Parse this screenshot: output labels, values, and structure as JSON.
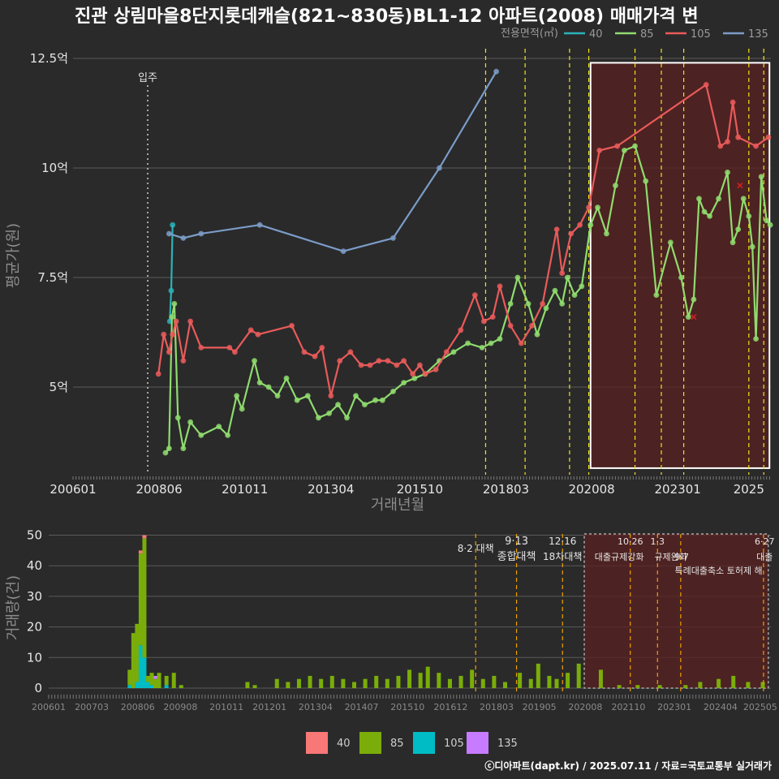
{
  "chart_data": [
    {
      "type": "line",
      "title": "진관 상림마을8단지롯데캐슬(821~830동)BL1-12 아파트(2008) 매매가격 변",
      "xlabel": "거래년월",
      "ylabel": "평균가(원)",
      "xticks": [
        "200601",
        "200806",
        "201011",
        "201304",
        "201510",
        "201803",
        "202008",
        "202301",
        "2025"
      ],
      "yticks": [
        {
          "v": 5,
          "label": "5억"
        },
        {
          "v": 7.5,
          "label": "7.5억"
        },
        {
          "v": 10,
          "label": "10억"
        },
        {
          "v": 12.5,
          "label": "12.5억"
        }
      ],
      "xlim": [
        2006.0,
        2025.62
      ],
      "ylim": [
        3.0,
        13.0
      ],
      "grid": true,
      "legend_title": "전용면적(㎡)",
      "legend_position": "top-right",
      "colors": {
        "40": "#2ab3b8",
        "85": "#8fdc6e",
        "105": "#ea5a5a",
        "135": "#7b9cc8",
        "policy": "#f5e31a",
        "highlight_fill": "#5a2020",
        "highlight_border": "#ffffff"
      },
      "move_in": {
        "x": 2008.1,
        "label": "입주"
      },
      "policy_lines": [
        2017.6,
        2018.71,
        2019.96,
        2020.5,
        2021.8,
        2022.54,
        2023.17,
        2025.0,
        2025.42
      ],
      "highlight": {
        "x0": 2020.55,
        "x1": 2025.58,
        "y0": 3.15,
        "y1": 12.4
      },
      "series": [
        {
          "name": "40",
          "x": [
            2008.72,
            2008.76,
            2008.8
          ],
          "y": [
            6.5,
            7.2,
            8.7
          ]
        },
        {
          "name": "85",
          "x": [
            2008.6,
            2008.7,
            2008.78,
            2008.85,
            2008.95,
            2009.1,
            2009.3,
            2009.6,
            2010.1,
            2010.35,
            2010.6,
            2010.75,
            2011.1,
            2011.25,
            2011.5,
            2011.75,
            2012.0,
            2012.3,
            2012.6,
            2012.9,
            2013.2,
            2013.45,
            2013.7,
            2013.95,
            2014.2,
            2014.5,
            2014.7,
            2015.0,
            2015.3,
            2015.6,
            2015.9,
            2016.3,
            2016.7,
            2017.1,
            2017.5,
            2017.75,
            2018.0,
            2018.3,
            2018.5,
            2018.8,
            2019.05,
            2019.3,
            2019.55,
            2019.75,
            2019.9,
            2020.1,
            2020.3,
            2020.55,
            2020.75,
            2021.0,
            2021.25,
            2021.5,
            2021.8,
            2022.1,
            2022.4,
            2022.8,
            2023.1,
            2023.3,
            2023.45,
            2023.6,
            2023.75,
            2023.9,
            2024.15,
            2024.4,
            2024.55,
            2024.7,
            2024.85,
            2025.0,
            2025.1,
            2025.2,
            2025.35,
            2025.5,
            2025.6
          ],
          "y": [
            3.5,
            3.6,
            6.6,
            6.9,
            4.3,
            3.6,
            4.2,
            3.9,
            4.1,
            3.9,
            4.8,
            4.5,
            5.6,
            5.1,
            5.0,
            4.8,
            5.2,
            4.7,
            4.8,
            4.3,
            4.4,
            4.6,
            4.3,
            4.8,
            4.6,
            4.7,
            4.7,
            4.9,
            5.1,
            5.2,
            5.3,
            5.6,
            5.8,
            6.0,
            5.9,
            6.0,
            6.1,
            6.9,
            7.5,
            6.9,
            6.2,
            6.8,
            7.2,
            6.9,
            7.5,
            7.1,
            7.3,
            8.7,
            9.1,
            8.5,
            9.6,
            10.4,
            10.5,
            9.7,
            7.1,
            8.3,
            7.5,
            6.6,
            7.0,
            9.3,
            9.0,
            8.9,
            9.3,
            9.9,
            8.3,
            8.6,
            9.3,
            8.9,
            8.2,
            6.1,
            9.8,
            8.8,
            8.7
          ]
        },
        {
          "name": "105",
          "x": [
            2008.4,
            2008.55,
            2008.7,
            2008.8,
            2008.9,
            2009.1,
            2009.3,
            2009.6,
            2010.4,
            2010.55,
            2011.0,
            2011.2,
            2012.15,
            2012.5,
            2012.8,
            2013.0,
            2013.25,
            2013.5,
            2013.8,
            2014.1,
            2014.35,
            2014.6,
            2014.85,
            2015.1,
            2015.3,
            2015.55,
            2015.75,
            2015.9,
            2016.2,
            2016.5,
            2016.9,
            2017.3,
            2017.55,
            2017.8,
            2018.0,
            2018.3,
            2018.6,
            2018.9,
            2019.2,
            2019.6,
            2019.75,
            2020.0,
            2020.25,
            2020.5,
            2020.8,
            2021.3,
            2023.8,
            2024.2,
            2024.4,
            2024.55,
            2024.7,
            2025.2,
            2025.55
          ],
          "y": [
            5.3,
            6.2,
            5.8,
            6.2,
            6.5,
            5.6,
            6.5,
            5.9,
            5.9,
            5.8,
            6.3,
            6.2,
            6.4,
            5.8,
            5.7,
            5.9,
            4.8,
            5.6,
            5.8,
            5.5,
            5.5,
            5.6,
            5.6,
            5.5,
            5.6,
            5.3,
            5.5,
            5.3,
            5.4,
            5.8,
            6.3,
            7.1,
            6.5,
            6.6,
            7.3,
            6.4,
            6.0,
            6.4,
            6.9,
            8.6,
            7.6,
            8.5,
            8.7,
            9.1,
            10.4,
            10.5,
            11.9,
            10.5,
            10.6,
            11.5,
            10.7,
            10.5,
            10.7
          ]
        },
        {
          "name": "135",
          "x": [
            2008.7,
            2009.1,
            2009.6,
            2011.25,
            2013.6,
            2015.0,
            2016.3,
            2017.9
          ],
          "y": [
            8.5,
            8.4,
            8.5,
            8.7,
            8.1,
            8.4,
            10.0,
            12.2
          ]
        }
      ],
      "markers": [
        {
          "x": 2023.45,
          "y": 6.6,
          "series": "105"
        },
        {
          "x": 2024.75,
          "y": 9.6,
          "series": "105"
        }
      ]
    },
    {
      "type": "bar",
      "ylabel": "거래량(건)",
      "xticks": [
        "200601",
        "200703",
        "200806",
        "200908",
        "201011",
        "201201",
        "201304",
        "201407",
        "201510",
        "201612",
        "201803",
        "201905",
        "202008",
        "202110",
        "202301",
        "202404",
        "202505"
      ],
      "ylim": [
        0,
        52
      ],
      "yticks": [
        0,
        10,
        20,
        30,
        40,
        50
      ],
      "stacked": true,
      "series_colors": {
        "40": "#f87777",
        "85": "#7aad09",
        "105": "#00bcc4",
        "135": "#c77cff"
      },
      "legend": [
        "40",
        "85",
        "105",
        "135"
      ],
      "policies": [
        {
          "x": 2017.6,
          "label": "8·2 대책"
        },
        {
          "x": 2018.71,
          "label": "9·13 종합대책"
        },
        {
          "x": 2019.96,
          "label": "12·16 18차대책"
        },
        {
          "x": 2021.8,
          "label": "10·26 대출규제강화"
        },
        {
          "x": 2022.54,
          "label": "1·3 규제완화"
        },
        {
          "x": 2023.17,
          "label": "9·7 특례대출축소 토허제 해"
        },
        {
          "x": 2025.42,
          "label": "6·27 대출"
        }
      ],
      "counts_by_period": [
        {
          "x": 2008.2,
          "c85": 5,
          "c105": 1
        },
        {
          "x": 2008.3,
          "c85": 18
        },
        {
          "x": 2008.4,
          "c85": 19,
          "c105": 2
        },
        {
          "x": 2008.5,
          "c85": 30,
          "c105": 14,
          "c40": 1
        },
        {
          "x": 2008.6,
          "c85": 39,
          "c105": 10,
          "c40": 1
        },
        {
          "x": 2008.7,
          "c85": 2,
          "c105": 2
        },
        {
          "x": 2008.8,
          "c85": 4,
          "c105": 1
        },
        {
          "x": 2008.9,
          "c85": 3,
          "c135": 1
        },
        {
          "x": 2009.0,
          "c85": 5
        },
        {
          "x": 2009.2,
          "c85": 3,
          "c105": 1
        },
        {
          "x": 2009.4,
          "c85": 5
        },
        {
          "x": 2009.6,
          "c85": 1
        },
        {
          "x": 2011.4,
          "c85": 2
        },
        {
          "x": 2011.6,
          "c85": 1
        },
        {
          "x": 2012.2,
          "c85": 3
        },
        {
          "x": 2012.5,
          "c85": 2
        },
        {
          "x": 2012.8,
          "c85": 3
        },
        {
          "x": 2013.1,
          "c85": 4
        },
        {
          "x": 2013.4,
          "c85": 3
        },
        {
          "x": 2013.7,
          "c85": 4
        },
        {
          "x": 2014.0,
          "c85": 3
        },
        {
          "x": 2014.3,
          "c85": 2
        },
        {
          "x": 2014.6,
          "c85": 3
        },
        {
          "x": 2014.9,
          "c85": 4
        },
        {
          "x": 2015.2,
          "c85": 3
        },
        {
          "x": 2015.5,
          "c85": 4
        },
        {
          "x": 2015.8,
          "c85": 6
        },
        {
          "x": 2016.1,
          "c85": 5
        },
        {
          "x": 2016.3,
          "c85": 7
        },
        {
          "x": 2016.6,
          "c85": 5
        },
        {
          "x": 2016.9,
          "c85": 3
        },
        {
          "x": 2017.2,
          "c85": 4
        },
        {
          "x": 2017.5,
          "c85": 6
        },
        {
          "x": 2017.8,
          "c85": 3
        },
        {
          "x": 2018.1,
          "c85": 4
        },
        {
          "x": 2018.4,
          "c85": 2
        },
        {
          "x": 2018.8,
          "c85": 5
        },
        {
          "x": 2019.1,
          "c85": 3
        },
        {
          "x": 2019.3,
          "c85": 8
        },
        {
          "x": 2019.6,
          "c85": 4
        },
        {
          "x": 2019.8,
          "c85": 3
        },
        {
          "x": 2020.1,
          "c85": 5
        },
        {
          "x": 2020.4,
          "c85": 8
        },
        {
          "x": 2021.0,
          "c85": 6
        },
        {
          "x": 2021.5,
          "c85": 1
        },
        {
          "x": 2022.0,
          "c85": 1
        },
        {
          "x": 2022.6,
          "c85": 1
        },
        {
          "x": 2023.3,
          "c85": 1
        },
        {
          "x": 2023.7,
          "c85": 2
        },
        {
          "x": 2024.2,
          "c85": 3
        },
        {
          "x": 2024.6,
          "c85": 4
        },
        {
          "x": 2025.0,
          "c85": 2
        },
        {
          "x": 2025.4,
          "c85": 2
        }
      ]
    }
  ],
  "credit": "ⓒ디아파트(dapt.kr) / 2025.07.11 / 자료=국토교통부 실거래가"
}
